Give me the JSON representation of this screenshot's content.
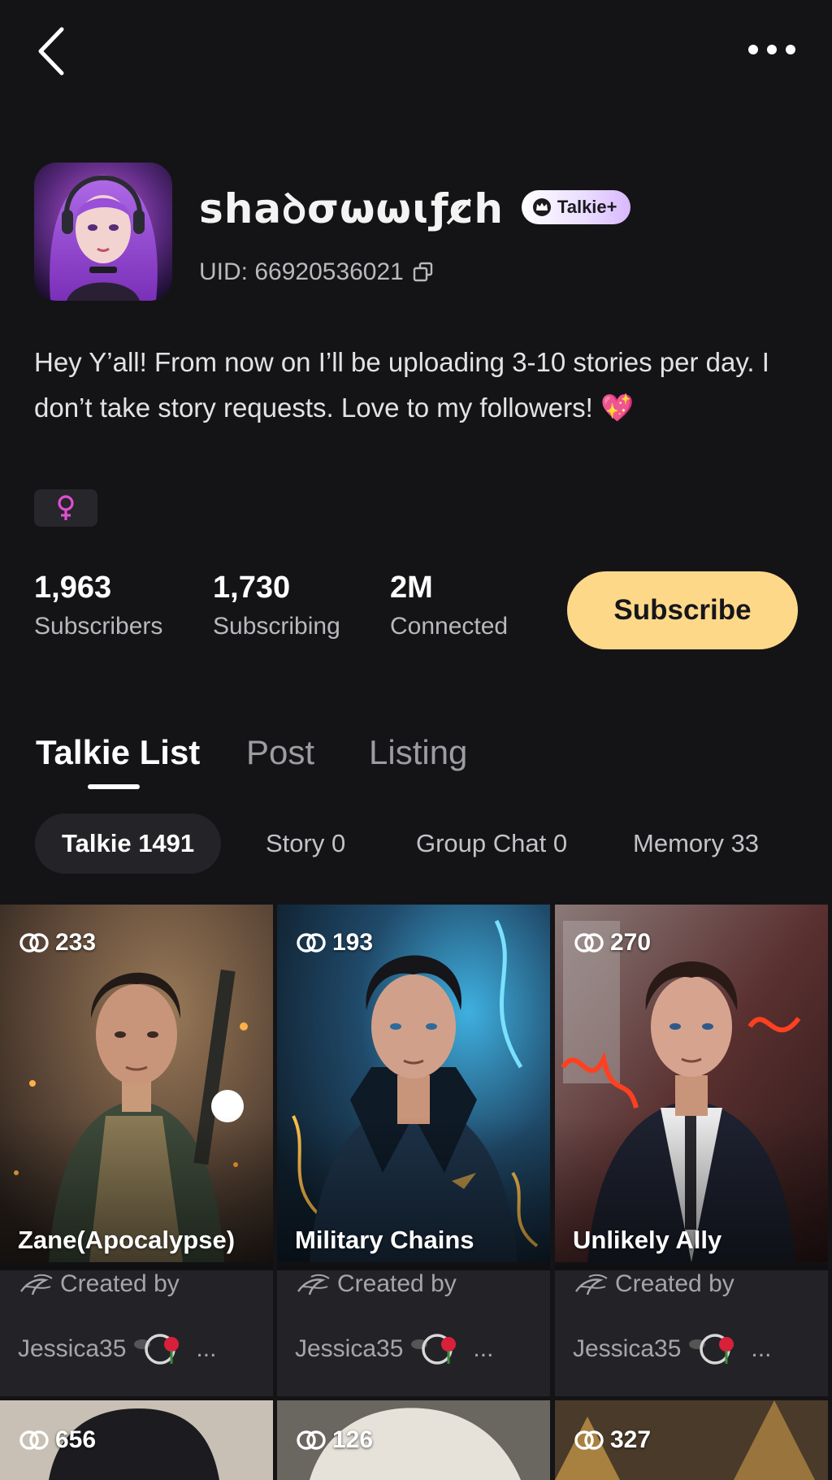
{
  "header": {
    "back_icon": "chevron-left-icon",
    "more_icon": "more-horizontal-icon"
  },
  "profile": {
    "username": "ꜱhaꝺσωωɩƒc̷h",
    "badge": "Talkie+",
    "uid": "UID: 66920536021",
    "bio": "Hey Y’all! From now on I’ll be uploading 3-10 stories per day. I don’t take story requests. Love to my followers! 💖",
    "gender_symbol": "♀"
  },
  "stats": [
    {
      "value": "1,963",
      "label": "Subscribers"
    },
    {
      "value": "1,730",
      "label": "Subscribing"
    },
    {
      "value": "2M",
      "label": "Connected"
    }
  ],
  "subscribe_label": "Subscribe",
  "tabs": [
    {
      "label": "Talkie List",
      "active": true
    },
    {
      "label": "Post",
      "active": false
    },
    {
      "label": "Listing",
      "active": false
    }
  ],
  "chips": [
    {
      "label": "Talkie 1491",
      "active": true
    },
    {
      "label": "Story 0",
      "active": false
    },
    {
      "label": "Group Chat 0",
      "active": false
    },
    {
      "label": "Memory 33",
      "active": false
    }
  ],
  "cards": [
    {
      "count": "233",
      "title": "Zane(Apocalypse)",
      "created_label": "Created by",
      "author": "Jessica35",
      "more": "..."
    },
    {
      "count": "193",
      "title": "Military Chains",
      "created_label": "Created by",
      "author": "Jessica35",
      "more": "..."
    },
    {
      "count": "270",
      "title": "Unlikely Ally",
      "created_label": "Created by",
      "author": "Jessica35",
      "more": "..."
    }
  ],
  "cards_row2": [
    {
      "count": "656"
    },
    {
      "count": "126"
    },
    {
      "count": "327"
    }
  ],
  "colors": {
    "background": "#141417",
    "accent_button": "#fdd889",
    "gender_pink": "#e04fd0"
  }
}
